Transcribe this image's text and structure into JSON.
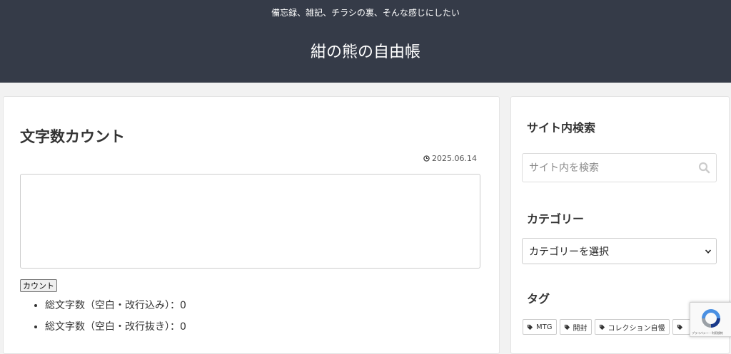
{
  "header": {
    "tagline": "備忘録、雑記、チラシの裏、そんな感じにしたい",
    "site_title": "紺の熊の自由帳"
  },
  "main": {
    "title": "文字数カウント",
    "date": "2025.06.14",
    "textarea_value": "",
    "count_button": "カウント",
    "results": [
      "総文字数（空白・改行込み）：0",
      "総文字数（空白・改行抜き）：0"
    ]
  },
  "sidebar": {
    "search_title": "サイト内検索",
    "search_placeholder": "サイト内を検索",
    "category_title": "カテゴリー",
    "category_selected": "カテゴリーを選択",
    "tag_title": "タグ",
    "tags": [
      "MTG",
      "開封",
      "コレクション自慢",
      ""
    ]
  },
  "recaptcha": {
    "text": "プライバシー・利用規約"
  },
  "colors": {
    "header_bg": "#353b48",
    "page_bg": "#f2f2f2",
    "card_bg": "#ffffff"
  },
  "icons": [
    "clock-icon",
    "search-icon",
    "chevron-down-icon",
    "tag-icon",
    "recaptcha-logo"
  ]
}
